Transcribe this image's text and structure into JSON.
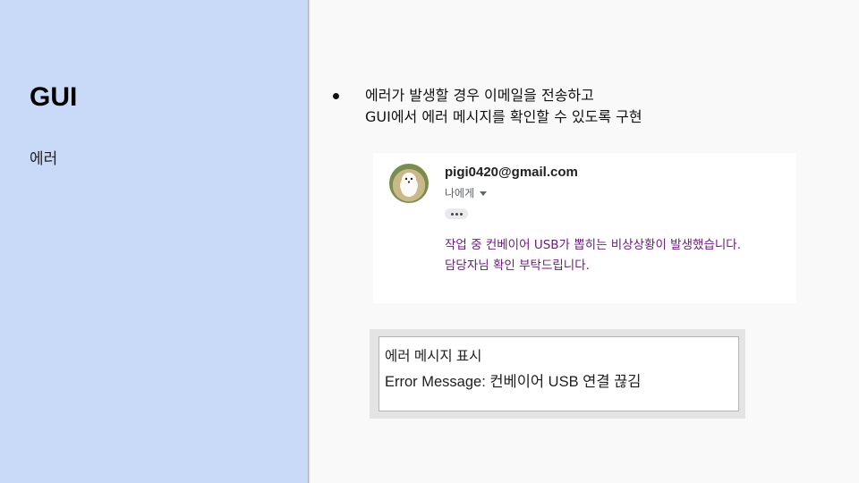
{
  "slide": {
    "title": "GUI",
    "subtitle": "에러",
    "bullet": {
      "line1": "에러가 발생할 경우 이메일을 전송하고",
      "line2": "GUI에서 에러 메시지를 확인할 수 있도록 구현"
    }
  },
  "email": {
    "sender": "pigi0420@gmail.com",
    "recipient": "나에게",
    "body_line1": "작업 중 컨베이어 USB가 뽑히는 비상상황이 발생했습니다.",
    "body_line2": "담당자님 확인 부탁드립니다.",
    "body_color": "#6a1b7a"
  },
  "error_window": {
    "title": "에러 메시지 표시",
    "message": "Error Message: 컨베이어 USB 연결 끊김"
  },
  "colors": {
    "left_panel": "#c9daf8",
    "background": "#f9f9f9"
  }
}
